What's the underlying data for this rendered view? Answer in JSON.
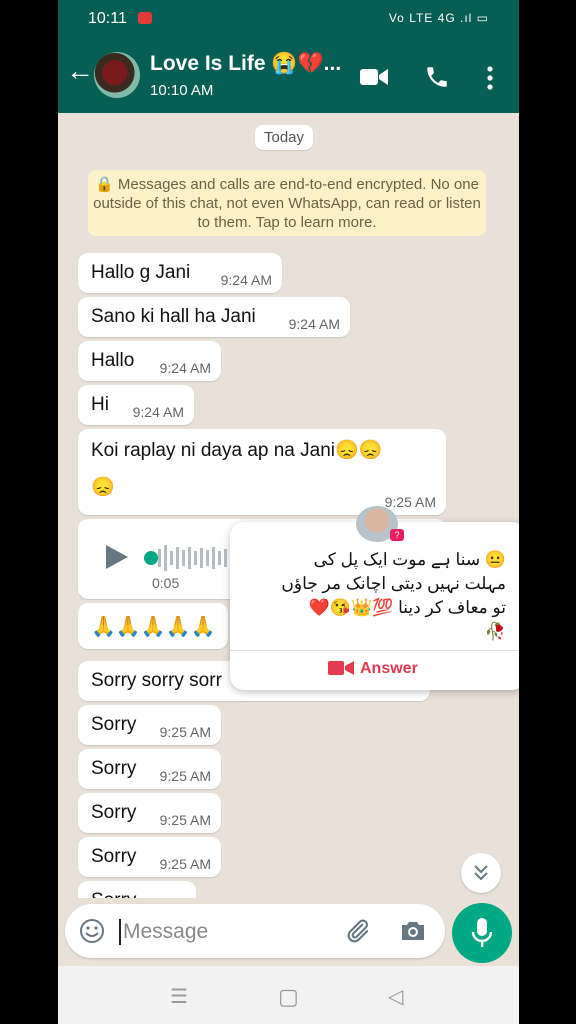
{
  "status_bar": {
    "time": "10:11",
    "system_icons": "Vo LTE 4G .ıl ▭"
  },
  "header": {
    "title": "Love Is Life 😭💔...",
    "subtitle": "10:10 AM",
    "icons": [
      "back-arrow-icon",
      "video-call-icon",
      "voice-call-icon",
      "more-options-icon"
    ],
    "color": "#075e54"
  },
  "chat": {
    "date_chip": "Today",
    "encryption_notice": "🔒 Messages and calls are end-to-end encrypted. No one outside of this chat, not even WhatsApp, can read or listen to them. Tap to learn more.",
    "messages": [
      {
        "text": "Hallo g Jani",
        "time": "9:24 AM"
      },
      {
        "text": "Sano ki hall ha Jani",
        "time": "9:24 AM"
      },
      {
        "text": "Hallo",
        "time": "9:24 AM"
      },
      {
        "text": "Hi",
        "time": "9:24 AM"
      },
      {
        "text": "Koi raplay ni daya ap na Jani😞😞",
        "text2": "😞",
        "time": "9:25 AM"
      },
      {
        "type": "voice",
        "duration": "0:05"
      },
      {
        "text": "🙏🙏🙏🙏🙏"
      },
      {
        "text": "Sorry sorry sorr"
      },
      {
        "text": "Sorry",
        "time": "9:25 AM"
      },
      {
        "text": "Sorry",
        "time": "9:25 AM"
      },
      {
        "text": "Sorry",
        "time": "9:25 AM"
      },
      {
        "text": "Sorry",
        "time": "9:25 AM"
      },
      {
        "text": "Sorry"
      }
    ]
  },
  "notification": {
    "text": "😐 سنا ہے موت ایک پل کی\nمہلت نہیں دیتی اچانک مر جاؤں\nتو معاف کر دینا 💯👑😘❤️\n🥀",
    "badge": "?",
    "action": "Answer",
    "accent": "#e53950"
  },
  "composer": {
    "placeholder": "Message",
    "value": "",
    "icons": [
      "emoji-icon",
      "attach-icon",
      "camera-icon",
      "mic-icon"
    ],
    "accent": "#00a884"
  },
  "nav": {
    "icons": [
      "menu-nav-icon",
      "home-nav-icon",
      "back-nav-icon"
    ],
    "menu": "☰",
    "home": "▢",
    "back": "◁"
  }
}
